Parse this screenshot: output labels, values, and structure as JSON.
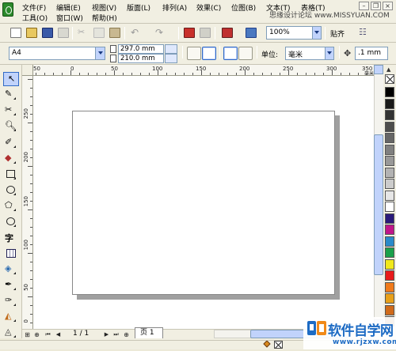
{
  "menu": {
    "row1": [
      "文件(F)",
      "编辑(E)",
      "视图(V)",
      "版面(L)",
      "排列(A)",
      "效果(C)",
      "位图(B)",
      "文本(T)",
      "表格(T)"
    ],
    "row2": [
      "工具(O)",
      "窗口(W)",
      "帮助(H)"
    ]
  },
  "watermark_text": "思缘设计论坛  www.MISSYUAN.COM",
  "toolbar": {
    "zoom_value": "100%",
    "snap_label": "贴齐"
  },
  "property_bar": {
    "paper_size": "A4",
    "width_value": "297.0 mm",
    "height_value": "210.0 mm",
    "unit_label": "单位:",
    "unit_value": "毫米",
    "nudge_value": ".1 mm"
  },
  "rulers": {
    "horizontal_labels": [
      "50",
      "0",
      "50",
      "100",
      "150",
      "200",
      "250",
      "300",
      "350"
    ],
    "horizontal_unit": "毫米",
    "vertical_labels": [
      "250",
      "200",
      "150",
      "100",
      "50",
      "0"
    ]
  },
  "navigator": {
    "page_count": "1 / 1",
    "page_tab": "页 1"
  },
  "palette_colors": [
    "#ffffff",
    "#000000",
    "#1a1a1a",
    "#333333",
    "#4d4d4d",
    "#666666",
    "#808080",
    "#999999",
    "#b3b3b3",
    "#cccccc",
    "#e6e6e6",
    "#ffffff",
    "#2a1a7a",
    "#c0168a",
    "#2a8aca",
    "#1aa04a",
    "#f0e81a",
    "#e81a1a",
    "#f07a1a",
    "#e8a01a",
    "#d06a1a",
    "#9a5a1a"
  ],
  "brand": {
    "name": "软件自学网",
    "url": "www.rjzxw.com"
  }
}
